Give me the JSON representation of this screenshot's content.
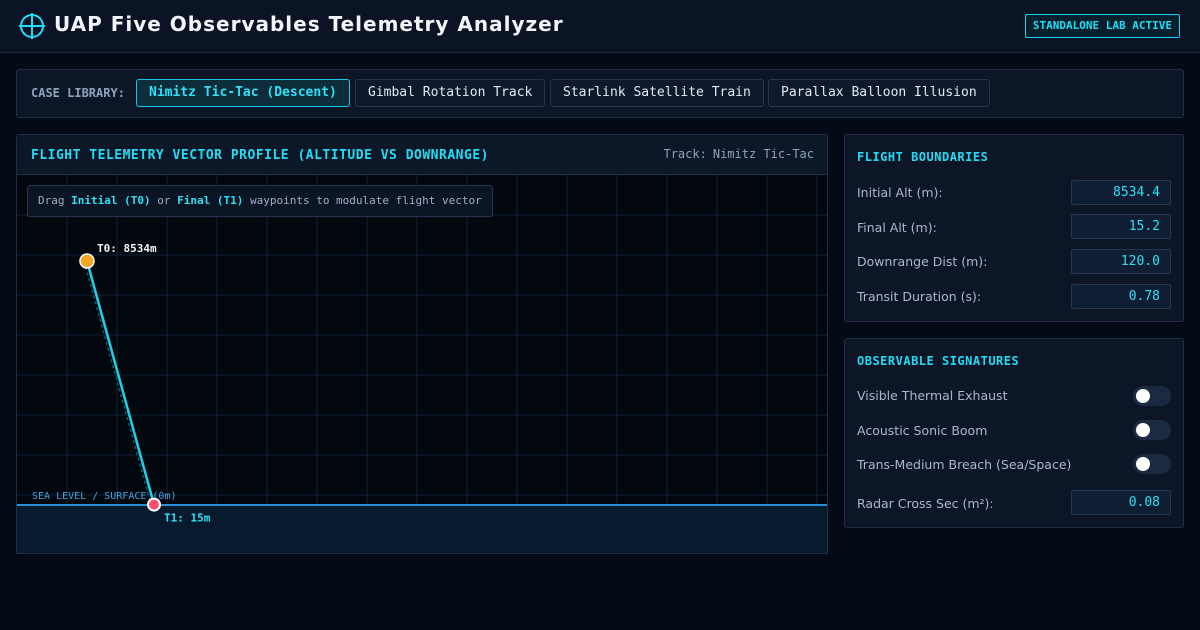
{
  "header": {
    "title": "UAP Five Observables Telemetry Analyzer",
    "logo_icon": "crosshair-icon",
    "status_badge": "STANDALONE LAB ACTIVE",
    "accent_color": "#22dcf5"
  },
  "case_library": {
    "label": "CASE LIBRARY:",
    "active_index": 0,
    "cases": [
      {
        "label": "Nimitz Tic-Tac (Descent)"
      },
      {
        "label": "Gimbal Rotation Track"
      },
      {
        "label": "Starlink Satellite Train"
      },
      {
        "label": "Parallax Balloon Illusion"
      }
    ]
  },
  "chart_panel": {
    "title": "FLIGHT TELEMETRY VECTOR PROFILE (ALTITUDE VS DOWNRANGE)",
    "track_prefix": "Track:",
    "track_name": "Nimitz Tic-Tac",
    "hint": {
      "prefix": "Drag ",
      "initial": "Initial (T0)",
      "middle": " or ",
      "final": "Final (T1)",
      "suffix": " waypoints to modulate flight vector"
    },
    "sea_level_label": "SEA LEVEL / SURFACE (0m)",
    "t0_label": "T0: 8534m",
    "t1_label": "T1: 15m",
    "t0_color": "#f6a623",
    "t1_color": "#ff4d6d",
    "vector_color": "#1fd0e8"
  },
  "chart_data": {
    "type": "line",
    "series": [
      {
        "values": [
          8534.4,
          15.2
        ]
      }
    ],
    "x": [
      0,
      120.0
    ]
  },
  "flight_boundaries": {
    "title": "FLIGHT BOUNDARIES",
    "fields": [
      {
        "label": "Initial Alt (m):",
        "value": "8534.4"
      },
      {
        "label": "Final Alt (m):",
        "value": "15.2"
      },
      {
        "label": "Downrange Dist (m):",
        "value": "120.0"
      },
      {
        "label": "Transit Duration (s):",
        "value": "0.78"
      }
    ]
  },
  "observable_signatures": {
    "title": "OBSERVABLE SIGNATURES",
    "toggles": [
      {
        "label": "Visible Thermal Exhaust",
        "on": false
      },
      {
        "label": "Acoustic Sonic Boom",
        "on": false
      },
      {
        "label": "Trans-Medium Breach (Sea/Space)",
        "on": false
      }
    ],
    "radar": {
      "label": "Radar Cross Sec (m²):",
      "value": "0.08"
    }
  }
}
